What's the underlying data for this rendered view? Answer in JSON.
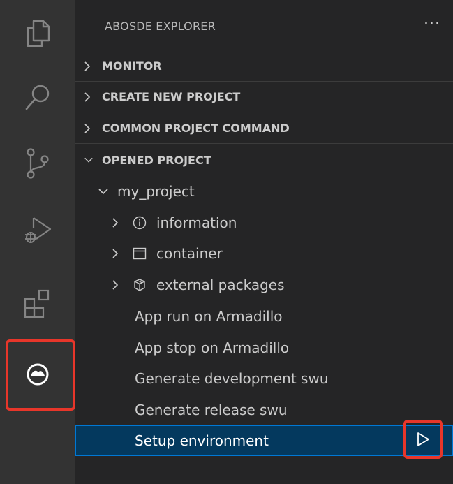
{
  "activity_bar": {
    "items": [
      {
        "icon": "files-icon"
      },
      {
        "icon": "search-icon"
      },
      {
        "icon": "source-control-icon"
      },
      {
        "icon": "run-debug-icon"
      },
      {
        "icon": "extensions-icon"
      },
      {
        "icon": "abosde-icon"
      }
    ],
    "highlight_color": "#e8362a"
  },
  "explorer": {
    "title": "ABOSDE EXPLORER",
    "more_label": "···"
  },
  "sections": {
    "monitor": "MONITOR",
    "create_new_project": "CREATE NEW PROJECT",
    "common_project_command": "COMMON PROJECT COMMAND",
    "opened_project": "OPENED PROJECT"
  },
  "tree": {
    "project": "my_project",
    "information": "information",
    "container": "container",
    "external_packages": "external packages",
    "app_run": "App run on Armadillo",
    "app_stop": "App stop on Armadillo",
    "gen_dev_swu": "Generate development swu",
    "gen_release_swu": "Generate release swu",
    "setup_environment": "Setup environment"
  },
  "colors": {
    "selection": "#04395e",
    "selection_border": "#0078d4"
  }
}
